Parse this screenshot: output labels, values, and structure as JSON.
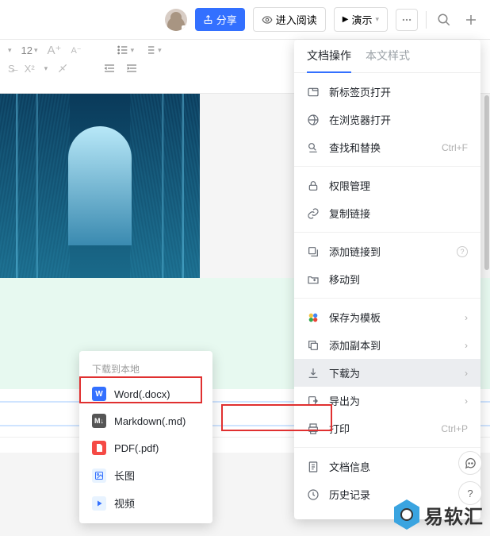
{
  "topbar": {
    "share": "分享",
    "read": "进入阅读",
    "present": "演示"
  },
  "toolbar": {
    "fontsize": "12",
    "x2": "X²"
  },
  "menu": {
    "tabs": [
      "文档操作",
      "本文样式"
    ],
    "sec1": [
      {
        "icon": "newtab",
        "label": "新标签页打开"
      },
      {
        "icon": "browser",
        "label": "在浏览器打开"
      },
      {
        "icon": "findrep",
        "label": "查找和替换",
        "tail": "Ctrl+F"
      }
    ],
    "sec2": [
      {
        "icon": "lock",
        "label": "权限管理"
      },
      {
        "icon": "link",
        "label": "复制链接"
      }
    ],
    "sec3": [
      {
        "icon": "linkto",
        "label": "添加链接到",
        "q": true
      },
      {
        "icon": "moveto",
        "label": "移动到"
      }
    ],
    "sec4": [
      {
        "icon": "tpl",
        "label": "保存为模板",
        "arrow": true
      },
      {
        "icon": "copy",
        "label": "添加副本到",
        "arrow": true
      },
      {
        "icon": "download",
        "label": "下载为",
        "arrow": true,
        "hi": true
      },
      {
        "icon": "export",
        "label": "导出为",
        "arrow": true
      },
      {
        "icon": "print",
        "label": "打印",
        "tail": "Ctrl+P"
      }
    ],
    "sec5": [
      {
        "icon": "info",
        "label": "文档信息"
      },
      {
        "icon": "history",
        "label": "历史记录",
        "arrow": true
      }
    ]
  },
  "submenu": {
    "title": "下载到本地",
    "items": [
      {
        "ico": "w",
        "icoText": "W",
        "label": "Word(.docx)"
      },
      {
        "ico": "m",
        "icoText": "M↓",
        "label": "Markdown(.md)"
      },
      {
        "ico": "p",
        "icoText": "",
        "label": "PDF(.pdf)"
      },
      {
        "ico": "im",
        "icoText": "",
        "label": "长图"
      },
      {
        "ico": "vd",
        "icoText": "",
        "label": "视频"
      }
    ]
  },
  "logo": "易软汇"
}
